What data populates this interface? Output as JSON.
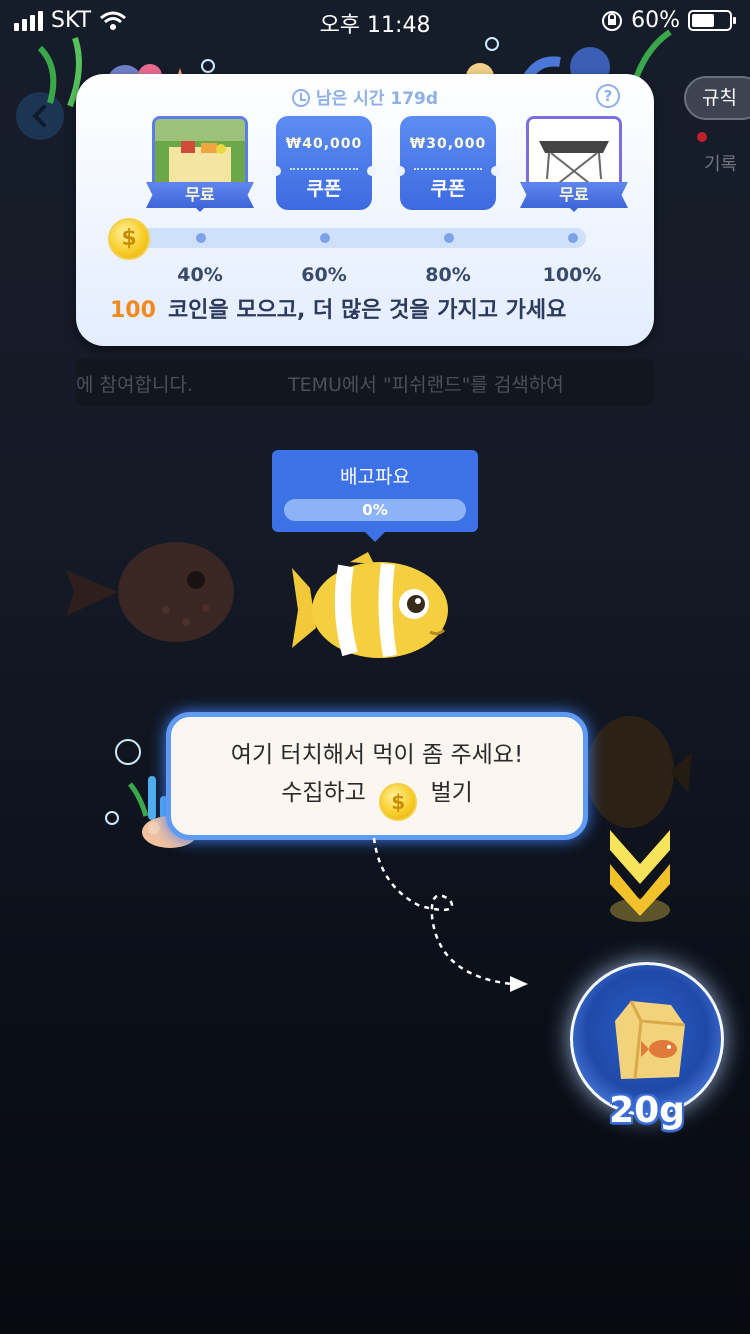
{
  "status_bar": {
    "carrier": "SKT",
    "time": "오후 11:48",
    "battery": "60%"
  },
  "header": {
    "rules_label": "규칙",
    "record_label": "기록"
  },
  "reward_card": {
    "remaining_time": "남은 시간 179d",
    "rewards": [
      {
        "type": "item",
        "label": "무료"
      },
      {
        "type": "coupon",
        "amount": "₩40,000",
        "label": "쿠폰"
      },
      {
        "type": "coupon",
        "amount": "₩30,000",
        "label": "쿠폰"
      },
      {
        "type": "item",
        "label": "무료"
      }
    ],
    "milestones": [
      "40%",
      "60%",
      "80%",
      "100%"
    ],
    "progress": 0,
    "collect_count": "100",
    "collect_text": "코인을 모으고, 더 많은 것을 가지고 가세요"
  },
  "marquee": {
    "left_text": "에 참여합니다.",
    "right_text": "TEMU에서 \"피쉬랜드\"를 검색하여"
  },
  "fish_status": {
    "title": "배고파요",
    "hunger_percent": "0%",
    "hunger_value": 0
  },
  "hint": {
    "line1": "여기 터치해서 먹이 좀 주세요!",
    "line2_prefix": "수집하고",
    "line2_suffix": "벌기"
  },
  "feed": {
    "amount": "20g"
  },
  "colors": {
    "accent": "#3d72e6",
    "coin": "#f8cd2a",
    "highlight": "#f08a1e"
  }
}
